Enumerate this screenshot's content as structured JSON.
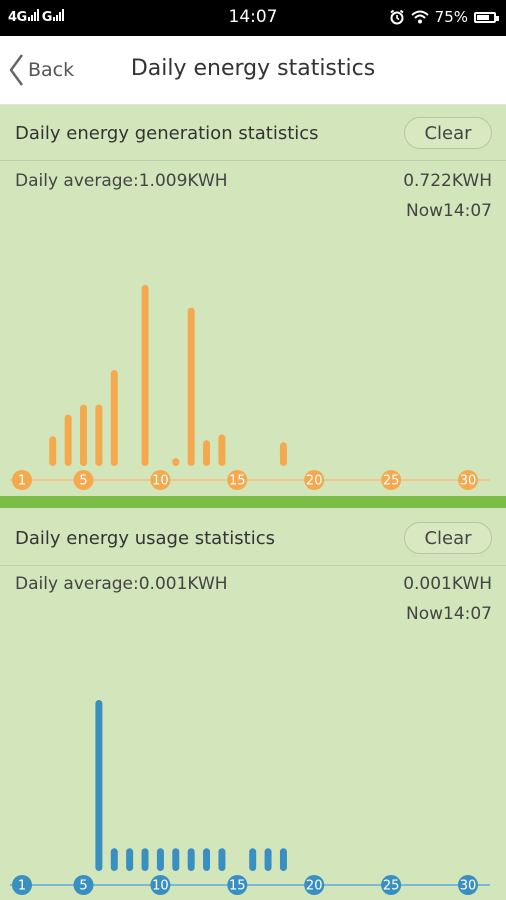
{
  "status_bar": {
    "network_left": "4G",
    "network_right": "G",
    "time": "14:07",
    "battery": "75%",
    "battery_level": 0.75,
    "icons": [
      "signal-icon",
      "alarm-icon",
      "wifi-icon",
      "battery-icon"
    ]
  },
  "header": {
    "back_label": "Back",
    "title": "Daily energy statistics"
  },
  "generation": {
    "title": "Daily energy generation statistics",
    "clear_label": "Clear",
    "average": "Daily average:1.009KWH",
    "today_value": "0.722KWH",
    "now": "Now14:07",
    "color": "#f5a94f"
  },
  "usage": {
    "title": "Daily energy usage statistics",
    "clear_label": "Clear",
    "average": "Daily average:0.001KWH",
    "today_value": "0.001KWH",
    "now": "Now14:07",
    "color": "#3a8fc1"
  },
  "chart_data": [
    {
      "type": "bar",
      "series_name": "Daily energy generation",
      "color": "#f5a94f",
      "x_tick_labels": [
        "1",
        "5",
        "10",
        "15",
        "20",
        "25",
        "30"
      ],
      "x": [
        3,
        4,
        5,
        6,
        7,
        9,
        11,
        12,
        13,
        14,
        18
      ],
      "values": [
        0.3,
        0.52,
        0.62,
        0.62,
        0.97,
        1.83,
        0.08,
        1.6,
        0.26,
        0.32,
        0.24
      ]
    },
    {
      "type": "bar",
      "series_name": "Daily energy usage",
      "color": "#3a8fc1",
      "x_tick_labels": [
        "1",
        "5",
        "10",
        "15",
        "20",
        "25",
        "30"
      ],
      "x": [
        6,
        7,
        8,
        9,
        10,
        11,
        12,
        13,
        14,
        16,
        17,
        18
      ],
      "values": [
        1.8,
        0.24,
        0.24,
        0.24,
        0.24,
        0.24,
        0.24,
        0.24,
        0.24,
        0.24,
        0.24,
        0.24
      ]
    }
  ]
}
